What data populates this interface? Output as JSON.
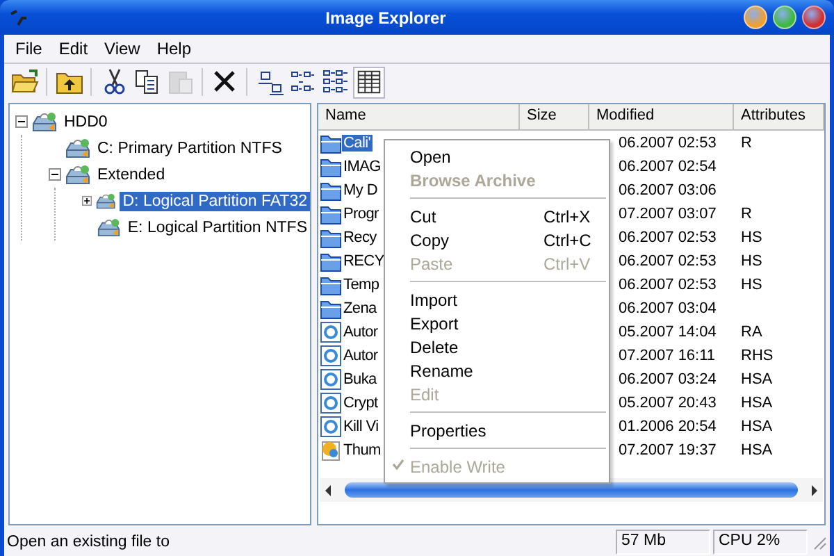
{
  "window": {
    "title": "Image Explorer"
  },
  "menu_bar": [
    "File",
    "Edit",
    "View",
    "Help"
  ],
  "toolbar": [
    {
      "kind": "open",
      "disabled": false,
      "selected": false
    },
    {
      "kind": "up",
      "disabled": false,
      "selected": false
    },
    {
      "kind": "cut",
      "disabled": false,
      "selected": false
    },
    {
      "kind": "copy",
      "disabled": false,
      "selected": false
    },
    {
      "kind": "paste",
      "disabled": true,
      "selected": false
    },
    {
      "kind": "delete",
      "disabled": false,
      "selected": false
    },
    {
      "kind": "large_icons",
      "disabled": false,
      "selected": false
    },
    {
      "kind": "small_icons",
      "disabled": false,
      "selected": false
    },
    {
      "kind": "list",
      "disabled": false,
      "selected": false
    },
    {
      "kind": "details",
      "disabled": false,
      "selected": true
    }
  ],
  "tree": [
    {
      "label": "HDD0",
      "selected": false,
      "expanded": true,
      "children": [
        {
          "label": "C: Primary Partition NTFS",
          "selected": false
        },
        {
          "label": "Extended",
          "selected": false,
          "expanded": true,
          "children": [
            {
              "label": "D: Logical Partition FAT32",
              "selected": true,
              "expanded": false
            },
            {
              "label": "E: Logical Partition NTFS",
              "selected": false
            }
          ]
        }
      ]
    }
  ],
  "file_list": {
    "columns": [
      "Name",
      "Size",
      "Modified",
      "Attributes"
    ],
    "rows": [
      {
        "kind": "folder",
        "name": "Cali'",
        "modified": "06.2007 02:53",
        "attributes": "R",
        "selected": true
      },
      {
        "kind": "folder",
        "name": "IMAG",
        "modified": "06.2007 02:54",
        "selected": false
      },
      {
        "kind": "folder",
        "name": "My D",
        "modified": "06.2007 03:06",
        "selected": false
      },
      {
        "kind": "folder",
        "name": "Progr",
        "modified": "07.2007 03:07",
        "attributes": "R",
        "selected": false
      },
      {
        "kind": "folder",
        "name": "Recy",
        "modified": "06.2007 02:53",
        "attributes": "HS",
        "selected": false
      },
      {
        "kind": "folder",
        "name": "RECY",
        "modified": "06.2007 02:53",
        "attributes": "HS",
        "selected": false
      },
      {
        "kind": "folder",
        "name": "Temp",
        "modified": "06.2007 02:53",
        "attributes": "HS",
        "selected": false
      },
      {
        "kind": "folder",
        "name": "Zena",
        "modified": "06.2007 03:04",
        "selected": false
      },
      {
        "kind": "app",
        "name": "Autor",
        "modified": "05.2007 14:04",
        "attributes": "RA",
        "selected": false
      },
      {
        "kind": "app",
        "name": "Autor",
        "modified": "07.2007 16:11",
        "attributes": "RHS",
        "selected": false
      },
      {
        "kind": "app",
        "name": "Buka",
        "modified": "06.2007 03:24",
        "attributes": "HSA",
        "selected": false
      },
      {
        "kind": "app",
        "name": "Crypt",
        "modified": "05.2007 20:43",
        "attributes": "HSA",
        "selected": false
      },
      {
        "kind": "app",
        "name": "Kill Vi",
        "modified": "01.2006 20:54",
        "attributes": "HSA",
        "selected": false
      },
      {
        "kind": "image",
        "name": "Thum",
        "modified": "07.2007 19:37",
        "attributes": "HSA",
        "selected": false
      }
    ]
  },
  "context_menu": [
    {
      "kind": "item",
      "label": "Open",
      "disabled": false
    },
    {
      "kind": "item",
      "label": "Browse Archive",
      "disabled": true,
      "bold": true
    },
    {
      "kind": "separator"
    },
    {
      "kind": "item",
      "label": "Cut",
      "shortcut": "Ctrl+X",
      "disabled": false
    },
    {
      "kind": "item",
      "label": "Copy",
      "shortcut": "Ctrl+C",
      "disabled": false
    },
    {
      "kind": "item",
      "label": "Paste",
      "shortcut": "Ctrl+V",
      "disabled": true
    },
    {
      "kind": "separator"
    },
    {
      "kind": "item",
      "label": "Import",
      "disabled": false
    },
    {
      "kind": "item",
      "label": "Export",
      "disabled": false
    },
    {
      "kind": "item",
      "label": "Delete",
      "disabled": false
    },
    {
      "kind": "item",
      "label": "Rename",
      "disabled": false
    },
    {
      "kind": "item",
      "label": "Edit",
      "disabled": true
    },
    {
      "kind": "separator"
    },
    {
      "kind": "item",
      "label": "Properties",
      "disabled": false
    },
    {
      "kind": "separator"
    },
    {
      "kind": "item",
      "label": "Enable Write",
      "disabled": true,
      "checked": true
    }
  ],
  "status_bar": {
    "message": "Open an existing file to",
    "memory": "57 Mb",
    "cpu": "CPU 2%"
  }
}
